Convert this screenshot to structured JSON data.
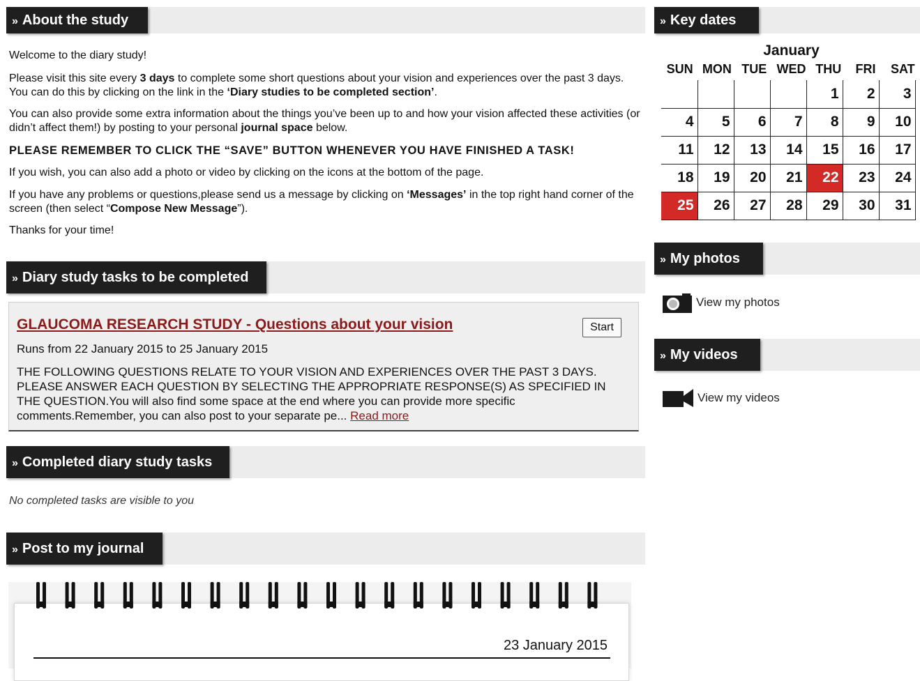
{
  "about": {
    "header": "About the study",
    "welcome": "Welcome to the diary study!",
    "p1_a": "Please visit this site every ",
    "p1_b": "3 days",
    "p1_c": " to complete some short questions about your vision and experiences over the past 3 days. You can do this by clicking on the link in the ",
    "p1_d": "‘Diary studies to be completed section’",
    "p1_e": ".",
    "p2_a": "You can also provide some extra information about the things you’ve been up to and how your vision affected these activities (or didn’t affect them!) by posting to your personal ",
    "p2_b": "journal space",
    "p2_c": " below.",
    "reminder": "PLEASE REMEMBER TO CLICK THE “SAVE” BUTTON WHENEVER YOU HAVE FINISHED A TASK!",
    "photo_hint": "If you wish, you can also add a photo or video by clicking on the icons at the bottom of the page.",
    "p3_a": "If you have any problems or questions,please send us a message by clicking on ",
    "p3_b": "‘Messages’",
    "p3_c": " in the top right hand corner of the screen (then select “",
    "p3_d": "Compose New Message",
    "p3_e": "”).",
    "thanks": "Thanks for your time!"
  },
  "tasks": {
    "header": "Diary study tasks to be completed",
    "title": "GLAUCOMA RESEARCH STUDY - Questions about your vision",
    "start_label": "Start",
    "runs": "Runs from 22 January 2015 to 25 January 2015",
    "description": "THE FOLLOWING QUESTIONS RELATE TO YOUR VISION AND EXPERIENCES OVER THE PAST 3 DAYS. PLEASE ANSWER EACH QUESTION BY SELECTING THE APPROPRIATE RESPONSE(S) AS SPECIFIED IN THE QUESTION.You will also find some space at the end where you can provide more specific comments.Remember, you can also post to your separate pe...",
    "read_more": "Read more"
  },
  "completed": {
    "header": "Completed diary study tasks",
    "empty_text": "No completed tasks are visible to you"
  },
  "journal": {
    "header": "Post to my journal",
    "date": "23 January 2015"
  },
  "key_dates": {
    "header": "Key dates",
    "month": "January",
    "weekdays": [
      "SUN",
      "MON",
      "TUE",
      "WED",
      "THU",
      "FRI",
      "SAT"
    ],
    "weeks": [
      [
        "",
        "",
        "",
        "",
        "1",
        "2",
        "3"
      ],
      [
        "4",
        "5",
        "6",
        "7",
        "8",
        "9",
        "10"
      ],
      [
        "11",
        "12",
        "13",
        "14",
        "15",
        "16",
        "17"
      ],
      [
        "18",
        "19",
        "20",
        "21",
        "22",
        "23",
        "24"
      ],
      [
        "25",
        "26",
        "27",
        "28",
        "29",
        "30",
        "31"
      ]
    ],
    "highlighted": [
      "22",
      "25"
    ],
    "highlight_color": "#d42a27"
  },
  "photos": {
    "header": "My photos",
    "link": "View my photos",
    "icon": "camera-icon"
  },
  "videos": {
    "header": "My videos",
    "link": "View my videos",
    "icon": "video-camera-icon"
  }
}
